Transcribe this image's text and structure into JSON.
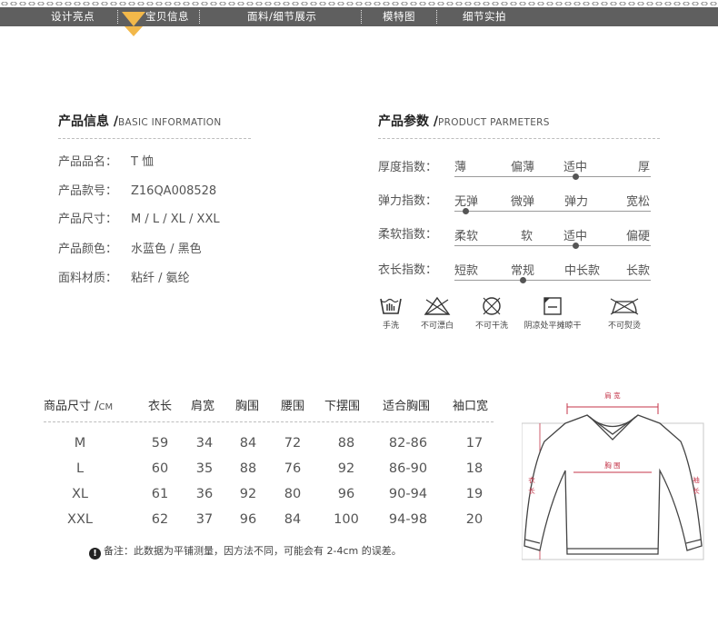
{
  "nav": {
    "items": [
      "设计亮点",
      "宝贝信息",
      "面料/细节展示",
      "模特图",
      "细节实拍"
    ],
    "active_index": 1,
    "bar_color": "#5f5f5f",
    "accent_color": "#f2b84a"
  },
  "basic_info": {
    "title_cn": "产品信息 /",
    "title_en": "BASIC INFORMATION",
    "rows": [
      {
        "label": "产品品名：",
        "value": "T 恤"
      },
      {
        "label": "产品款号：",
        "value": "Z16QA008528"
      },
      {
        "label": "产品尺寸：",
        "value": "M / L / XL / XXL"
      },
      {
        "label": "产品颜色：",
        "value": "水蓝色 / 黑色"
      },
      {
        "label": "面料材质：",
        "value": "粘纤 / 氨纶"
      }
    ]
  },
  "params": {
    "title_cn": "产品参数 /",
    "title_en": "PRODUCT PARMETERS",
    "rows": [
      {
        "label": "厚度指数：",
        "options": [
          "薄",
          "偏薄",
          "适中",
          "厚"
        ],
        "selected_fraction": 0.62
      },
      {
        "label": "弹力指数：",
        "options": [
          "无弹",
          "微弹",
          "弹力",
          "宽松"
        ],
        "selected_fraction": 0.06
      },
      {
        "label": "柔软指数：",
        "options": [
          "柔软",
          "软",
          "适中",
          "偏硬"
        ],
        "selected_fraction": 0.62
      },
      {
        "label": "衣长指数：",
        "options": [
          "短款",
          "常规",
          "中长款",
          "长款"
        ],
        "selected_fraction": 0.35
      }
    ]
  },
  "care": [
    {
      "icon": "hand-wash-icon",
      "label": "手洗"
    },
    {
      "icon": "no-bleach-icon",
      "label": "不可漂白"
    },
    {
      "icon": "no-dry-clean-icon",
      "label": "不可干洗"
    },
    {
      "icon": "shade-flat-dry-icon",
      "label": "阴凉处平摊晾干"
    },
    {
      "icon": "no-iron-icon",
      "label": "不可熨烫"
    }
  ],
  "size_table": {
    "header_cn": "商品尺寸 /",
    "header_unit": "CM",
    "columns": [
      "衣长",
      "肩宽",
      "胸围",
      "腰围",
      "下摆围",
      "适合胸围",
      "袖口宽"
    ],
    "rows": [
      {
        "size": "M",
        "values": [
          "59",
          "34",
          "84",
          "72",
          "88",
          "82-86",
          "17"
        ]
      },
      {
        "size": "L",
        "values": [
          "60",
          "35",
          "88",
          "76",
          "92",
          "86-90",
          "18"
        ]
      },
      {
        "size": "XL",
        "values": [
          "61",
          "36",
          "92",
          "80",
          "96",
          "90-94",
          "19"
        ]
      },
      {
        "size": "XXL",
        "values": [
          "62",
          "37",
          "96",
          "84",
          "100",
          "94-98",
          "20"
        ]
      }
    ],
    "note": "备注：此数据为平铺测量，因方法不同，可能会有 2-4cm 的误差。"
  },
  "diagram": {
    "shoulder_label": "肩 宽",
    "chest_label": "胸 围",
    "length_label_1": "衣",
    "length_label_2": "长",
    "sleeve_label_1": "袖",
    "sleeve_label_2": "长",
    "guide_color": "#c4364a"
  }
}
